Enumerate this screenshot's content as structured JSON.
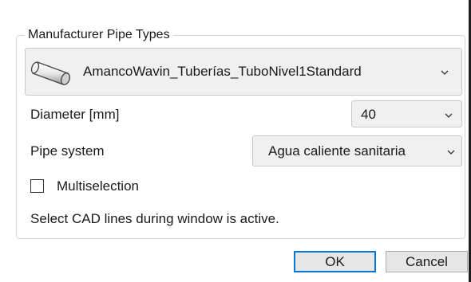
{
  "group": {
    "title": "Manufacturer Pipe Types"
  },
  "pipe_type": {
    "selected": "AmancoWavin_Tuberías_TuboNivel1Standard",
    "icon": "pipe-icon",
    "dropdown_icon": "chevron-down-icon"
  },
  "diameter": {
    "label": "Diameter [mm]",
    "selected": "40",
    "dropdown_icon": "chevron-down-icon"
  },
  "pipe_system": {
    "label": "Pipe system",
    "selected": "Agua caliente sanitaria",
    "dropdown_icon": "chevron-down-icon"
  },
  "multiselection": {
    "label": "Multiselection",
    "checked": false
  },
  "hint": "Select CAD lines during window is active.",
  "buttons": {
    "ok": "OK",
    "cancel": "Cancel"
  },
  "colors": {
    "accent": "#0078d7",
    "combo_bg": "#f0f0f0",
    "border": "#c8c8c8"
  }
}
